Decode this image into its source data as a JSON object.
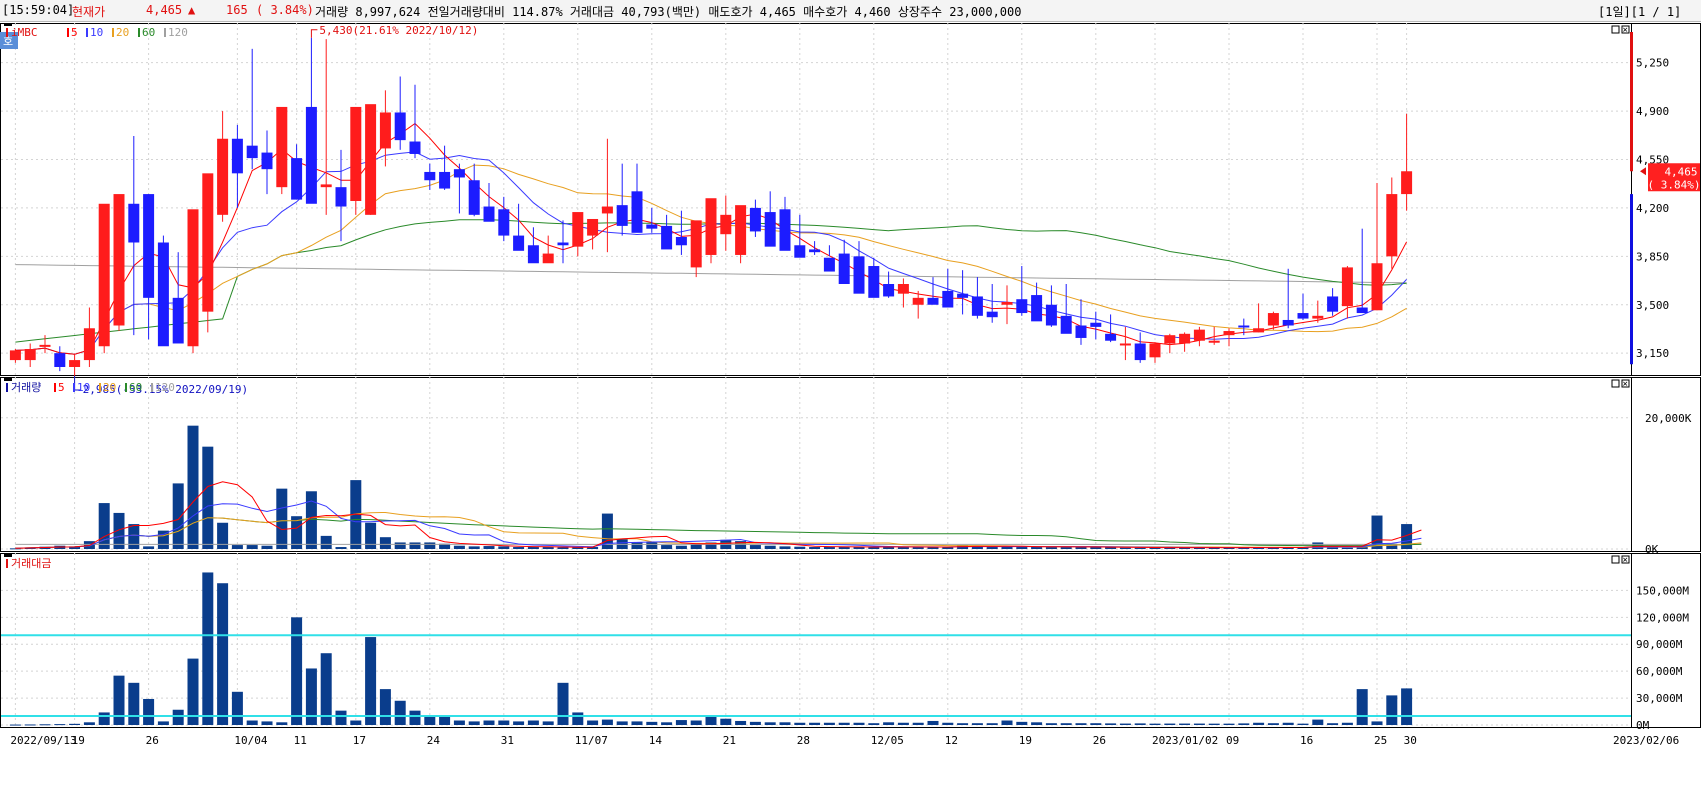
{
  "header": {
    "time": "[15:59:04]",
    "price_label": "현재가",
    "price": "4,465",
    "change_arrow": "▲",
    "change": "165",
    "change_pct": "( 3.84%)",
    "info_line": "거래량 8,997,624 전일거래량대비 114.87% 거래대금 40,793(백만) 매도호가 4,465 매수호가 4,460 상장주수 23,000,000",
    "period": "[1일][1 / 1]"
  },
  "side_tab": "호",
  "price_panel": {
    "legend_name": "iMBC",
    "legend_ma": [
      "5",
      "10",
      "20",
      "60",
      "120"
    ],
    "hi_annotation": "5,430(21.61% 2022/10/12)",
    "lo_annotation": "2,985(-33.15% 2022/09/19)",
    "y_ticks": [
      "5,250",
      "4,900",
      "4,550",
      "4,200",
      "3,850",
      "3,500",
      "3,150"
    ],
    "current_price": "4,465",
    "current_pct": "( 3.84%)"
  },
  "volume_panel": {
    "legend_name": "거래량",
    "legend_ma": [
      "5",
      "10",
      "20",
      "60",
      "120"
    ],
    "y_ticks": [
      "20,000K",
      "0K"
    ]
  },
  "amount_panel": {
    "legend_name": "거래대금",
    "y_ticks": [
      "150,000M",
      "120,000M",
      "90,000M",
      "60,000M",
      "30,000M",
      "0M"
    ]
  },
  "x_axis": {
    "labels": [
      "2022/09/13",
      "19",
      "26",
      "10/04",
      "11",
      "17",
      "24",
      "31",
      "11/07",
      "14",
      "21",
      "28",
      "12/05",
      "12",
      "19",
      "26",
      "2023/01/02",
      "09",
      "16",
      "25",
      "30",
      "2023/02/06"
    ]
  },
  "colors": {
    "up": "#ff1c1c",
    "down": "#1c1cff",
    "volume_bar": "#0a3d8c",
    "ma5": "#ff0000",
    "ma10": "#3a3aff",
    "ma20": "#e8a020",
    "ma60": "#2a8a2a",
    "ma120": "#a0a0a0",
    "ref_line": "#30e0e8"
  },
  "chart_data": {
    "type": "candlestick",
    "title": "iMBC",
    "x_dates": [
      "2022/09/13",
      "09/14",
      "09/15",
      "09/16",
      "09/19",
      "09/20",
      "09/21",
      "09/22",
      "09/23",
      "09/26",
      "09/27",
      "09/28",
      "09/29",
      "09/30",
      "10/04",
      "10/05",
      "10/06",
      "10/07",
      "10/11",
      "10/12",
      "10/13",
      "10/14",
      "10/17",
      "10/18",
      "10/19",
      "10/20",
      "10/21",
      "10/24",
      "10/25",
      "10/26",
      "10/27",
      "10/28",
      "10/31",
      "11/01",
      "11/02",
      "11/03",
      "11/04",
      "11/07",
      "11/08",
      "11/09",
      "11/10",
      "11/11",
      "11/14",
      "11/15",
      "11/16",
      "11/17",
      "11/18",
      "11/21",
      "11/22",
      "11/23",
      "11/24",
      "11/25",
      "11/28",
      "11/29",
      "11/30",
      "12/01",
      "12/02",
      "12/05",
      "12/06",
      "12/07",
      "12/08",
      "12/09",
      "12/12",
      "12/13",
      "12/14",
      "12/15",
      "12/16",
      "12/19",
      "12/20",
      "12/21",
      "12/22",
      "12/23",
      "12/26",
      "12/27",
      "12/28",
      "12/29",
      "2023/01/02",
      "01/03",
      "01/04",
      "01/05",
      "01/06",
      "01/09",
      "01/10",
      "01/11",
      "01/12",
      "01/13",
      "01/16",
      "01/17",
      "01/18",
      "01/19",
      "01/20",
      "01/25",
      "01/26",
      "01/27",
      "01/30"
    ],
    "open": [
      3100,
      3100,
      3200,
      3150,
      3050,
      3100,
      3200,
      3350,
      4230,
      4300,
      3950,
      3550,
      3200,
      3450,
      4150,
      4700,
      4650,
      4600,
      4350,
      4560,
      4930,
      4350,
      4350,
      4250,
      4150,
      4630,
      4890,
      4680,
      4460,
      4460,
      4480,
      4400,
      4210,
      4190,
      4000,
      3930,
      3800,
      3950,
      3920,
      4000,
      4160,
      4220,
      4320,
      4080,
      4070,
      3990,
      3770,
      3860,
      4010,
      3860,
      4200,
      4170,
      4190,
      3930,
      3900,
      3840,
      3870,
      3850,
      3780,
      3650,
      3580,
      3500,
      3550,
      3600,
      3580,
      3560,
      3450,
      3500,
      3540,
      3570,
      3500,
      3420,
      3350,
      3370,
      3290,
      3210,
      3220,
      3120,
      3220,
      3220,
      3240,
      3230,
      3280,
      3350,
      3300,
      3350,
      3390,
      3440,
      3400,
      3560,
      3490,
      3480,
      3460,
      3850,
      4300
    ],
    "high": [
      3180,
      3220,
      3280,
      3200,
      3140,
      3480,
      3700,
      4280,
      4720,
      4300,
      4000,
      3880,
      3800,
      4250,
      4900,
      4800,
      5350,
      4760,
      4650,
      4660,
      5430,
      5420,
      4620,
      4550,
      4700,
      5050,
      5150,
      5090,
      4520,
      4650,
      4520,
      4520,
      4380,
      4280,
      4230,
      4060,
      4000,
      4110,
      4000,
      4050,
      4700,
      4520,
      4520,
      4200,
      4150,
      4180,
      4000,
      4120,
      4290,
      4170,
      4260,
      4320,
      4280,
      4150,
      3960,
      3930,
      3970,
      3960,
      3840,
      3740,
      3690,
      3600,
      3700,
      3760,
      3750,
      3700,
      3650,
      3640,
      3780,
      3660,
      3640,
      3650,
      3540,
      3450,
      3430,
      3340,
      3300,
      3230,
      3290,
      3300,
      3340,
      3340,
      3330,
      3400,
      3510,
      3450,
      3760,
      3580,
      3530,
      3620,
      3780,
      4050,
      4380,
      4420,
      4880
    ],
    "low": [
      3080,
      3050,
      3150,
      3020,
      2985,
      3050,
      3150,
      3310,
      3280,
      3250,
      3700,
      3500,
      3150,
      3300,
      4100,
      4200,
      4480,
      4300,
      4300,
      4480,
      4400,
      4150,
      3960,
      4150,
      4150,
      4500,
      4620,
      4560,
      4330,
      4330,
      4160,
      4140,
      4150,
      3960,
      3930,
      3880,
      3810,
      3800,
      3850,
      3900,
      3880,
      4000,
      4030,
      4020,
      4050,
      3860,
      3700,
      3800,
      3890,
      3800,
      3990,
      4000,
      4020,
      3850,
      3860,
      3850,
      3840,
      3700,
      3650,
      3550,
      3480,
      3400,
      3540,
      3490,
      3430,
      3400,
      3370,
      3360,
      3420,
      3460,
      3340,
      3320,
      3210,
      3250,
      3230,
      3100,
      3080,
      3080,
      3150,
      3160,
      3200,
      3210,
      3200,
      3280,
      3300,
      3320,
      3330,
      3390,
      3370,
      3420,
      3400,
      3480,
      3460,
      3760,
      4180
    ],
    "close": [
      3170,
      3180,
      3210,
      3050,
      3100,
      3330,
      4230,
      4300,
      3950,
      3550,
      3200,
      3220,
      4190,
      4450,
      4700,
      4450,
      4560,
      4480,
      4930,
      4260,
      4230,
      4370,
      4210,
      4930,
      4950,
      4890,
      4690,
      4590,
      4400,
      4340,
      4420,
      4150,
      4100,
      4000,
      3890,
      3800,
      3870,
      3930,
      4170,
      4120,
      4210,
      4070,
      4020,
      4050,
      3900,
      3930,
      4110,
      4270,
      4150,
      4220,
      4030,
      3920,
      3890,
      3840,
      3880,
      3740,
      3650,
      3580,
      3550,
      3560,
      3650,
      3550,
      3500,
      3480,
      3550,
      3420,
      3410,
      3520,
      3440,
      3380,
      3350,
      3290,
      3260,
      3340,
      3240,
      3220,
      3100,
      3220,
      3280,
      3290,
      3320,
      3240,
      3310,
      3340,
      3330,
      3440,
      3350,
      3400,
      3420,
      3450,
      3770,
      3440,
      3800,
      4300,
      4465
    ],
    "volume_k": [
      100,
      250,
      350,
      500,
      400,
      1200,
      7000,
      5500,
      3800,
      400,
      2800,
      10000,
      18800,
      15600,
      4000,
      600,
      600,
      500,
      9200,
      5000,
      8800,
      2000,
      300,
      10500,
      4000,
      1800,
      1000,
      1000,
      1000,
      800,
      500,
      400,
      450,
      400,
      300,
      300,
      300,
      250,
      250,
      300,
      5400,
      1500,
      1000,
      1100,
      600,
      500,
      800,
      1000,
      1400,
      1200,
      600,
      500,
      400,
      350,
      300,
      300,
      300,
      350,
      300,
      350,
      300,
      300,
      300,
      300,
      600,
      500,
      300,
      350,
      300,
      400,
      300,
      300,
      300,
      300,
      250,
      200,
      200,
      200,
      250,
      200,
      250,
      200,
      200,
      200,
      300,
      200,
      250,
      200,
      1000,
      300,
      200,
      400,
      5100,
      800,
      3800,
      4400
    ],
    "amount_m": [
      500,
      600,
      800,
      1000,
      1300,
      3000,
      14000,
      55000,
      47000,
      29000,
      4000,
      17000,
      74000,
      170000,
      158000,
      37000,
      5000,
      4000,
      3000,
      120000,
      63000,
      80000,
      16000,
      5000,
      98000,
      40000,
      27000,
      16000,
      11000,
      9000,
      5000,
      4000,
      5000,
      5000,
      4000,
      5000,
      4000,
      47000,
      14000,
      5000,
      6000,
      4000,
      4000,
      3500,
      3000,
      5500,
      5000,
      10500,
      7000,
      4500,
      3500,
      3000,
      3000,
      2500,
      2500,
      2500,
      2500,
      2500,
      2000,
      3000,
      2500,
      2500,
      4500,
      2500,
      2000,
      2000,
      2000,
      5000,
      3500,
      3000,
      2000,
      2000,
      2000,
      2000,
      1800,
      1600,
      1800,
      1500,
      1600,
      1600,
      1600,
      1500,
      1500,
      1800,
      2500,
      2000,
      2500,
      1500,
      6000,
      2000,
      2500,
      40000,
      4000,
      33000,
      40793
    ],
    "price_ylim": [
      3050,
      5450
    ],
    "volume_ylim": [
      0,
      25000
    ],
    "amount_ylim": [
      0,
      185000
    ],
    "amount_ref_lines": [
      100000,
      10000
    ]
  }
}
